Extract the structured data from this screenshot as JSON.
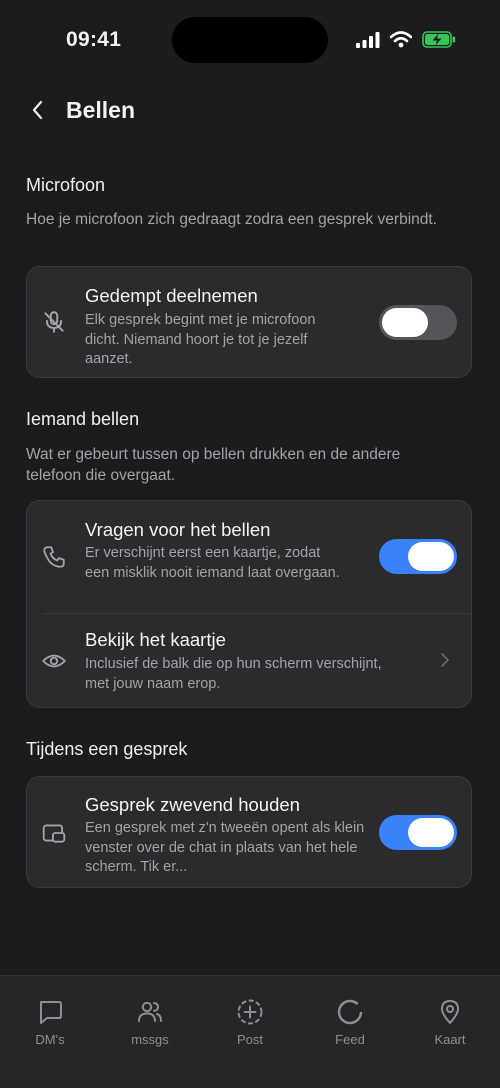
{
  "status_bar": {
    "time": "09:41"
  },
  "header": {
    "title": "Bellen"
  },
  "sections": [
    {
      "title": "Microfoon",
      "description": "Hoe je microfoon zich gedraagt zodra een gesprek verbindt.",
      "rows": [
        {
          "title": "Gedempt deelnemen",
          "subtitle": "Elk gesprek begint met je microfoon dicht. Niemand hoort je tot je jezelf aanzet.",
          "icon": "mic-off-icon",
          "toggle": false
        }
      ]
    },
    {
      "title": "Iemand bellen",
      "description": "Wat er gebeurt tussen op bellen drukken en de andere telefoon die overgaat.",
      "rows": [
        {
          "title": "Vragen voor het bellen",
          "subtitle": "Er verschijnt eerst een kaartje, zodat een misklik nooit iemand laat overgaan.",
          "icon": "phone-icon",
          "toggle": true
        },
        {
          "title": "Bekijk het kaartje",
          "subtitle": "Inclusief de balk die op hun scherm verschijnt, met jouw naam erop.",
          "icon": "eye-icon",
          "chevron": true
        }
      ]
    },
    {
      "title": "Tijdens een gesprek",
      "rows": [
        {
          "title": "Gesprek zwevend houden",
          "subtitle": "Een gesprek met z'n tweeën opent als klein venster over de chat in plaats van het hele scherm. Tik er...",
          "icon": "picture-in-picture-icon",
          "toggle": true
        }
      ]
    }
  ],
  "tabbar": {
    "items": [
      {
        "label": "DM's",
        "icon": "chat-bubble-icon"
      },
      {
        "label": "mssgs",
        "icon": "users-icon"
      },
      {
        "label": "Post",
        "icon": "plus-circle-icon"
      },
      {
        "label": "Feed",
        "icon": "circle-icon"
      },
      {
        "label": "Kaart",
        "icon": "map-pin-icon"
      }
    ]
  },
  "colors": {
    "background": "#1c1c1e",
    "card": "#2b2b2e",
    "accent": "#3a82f7",
    "battery": "#34c759"
  }
}
